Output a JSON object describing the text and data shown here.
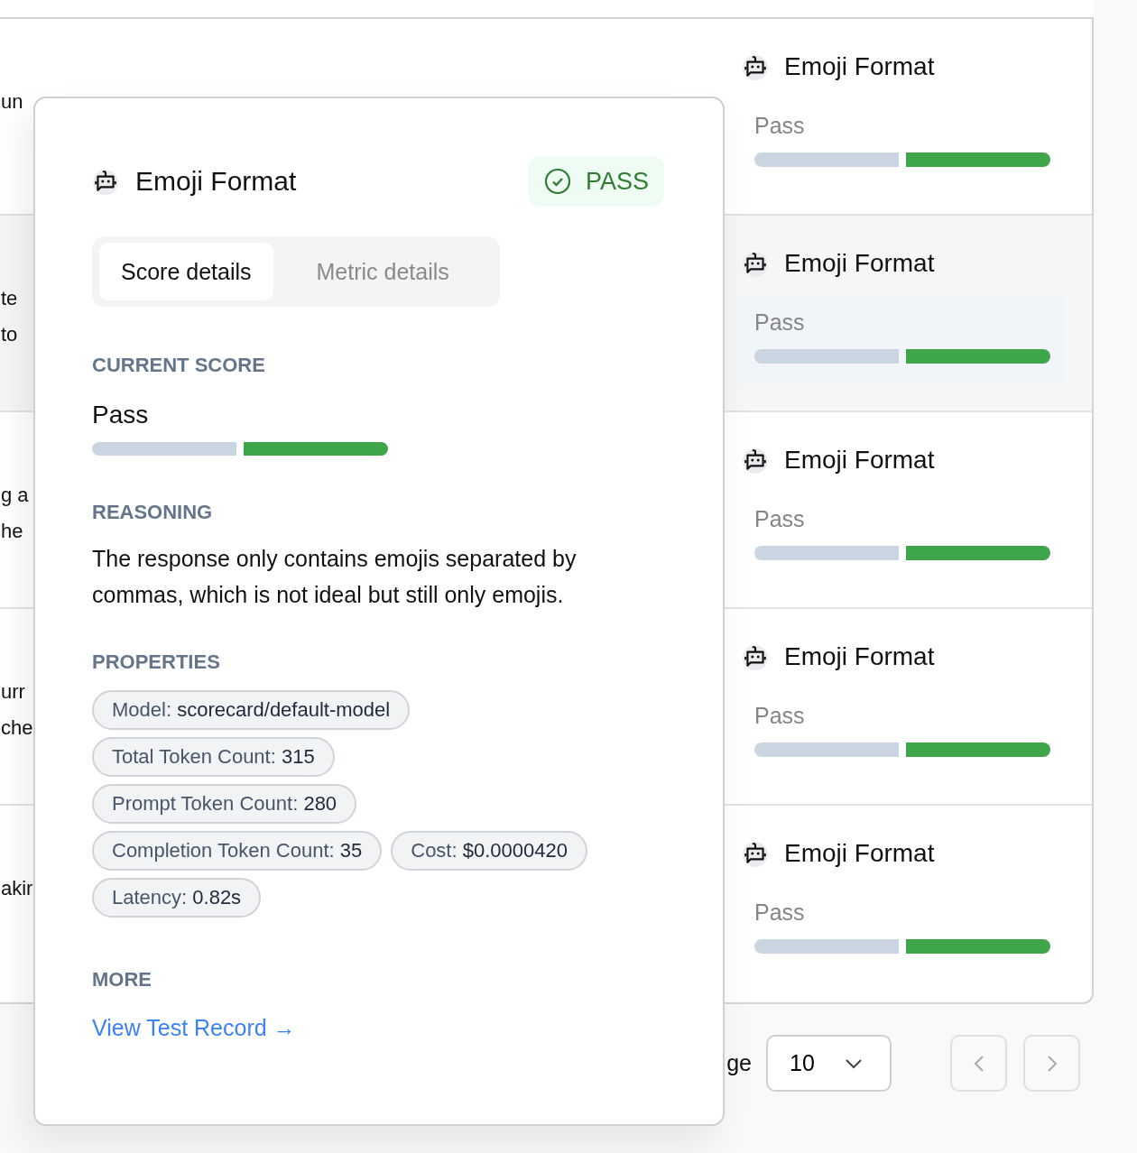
{
  "table": {
    "rows": [
      {
        "snippet": [
          "un"
        ],
        "metric": "Emoji Format",
        "score": "Pass",
        "segments": [
          {
            "on": false
          },
          {
            "on": true
          }
        ],
        "highlighted": false
      },
      {
        "snippet": [
          "te",
          "to"
        ],
        "metric": "Emoji Format",
        "score": "Pass",
        "segments": [
          {
            "on": false
          },
          {
            "on": true
          }
        ],
        "highlighted": true
      },
      {
        "snippet": [
          "g a",
          "he"
        ],
        "metric": "Emoji Format",
        "score": "Pass",
        "segments": [
          {
            "on": false
          },
          {
            "on": true
          }
        ],
        "highlighted": false
      },
      {
        "snippet": [
          "urr",
          "che"
        ],
        "metric": "Emoji Format",
        "score": "Pass",
        "segments": [
          {
            "on": false
          },
          {
            "on": true
          }
        ],
        "highlighted": false
      },
      {
        "snippet": [
          "akir"
        ],
        "metric": "Emoji Format",
        "score": "Pass",
        "segments": [
          {
            "on": false
          },
          {
            "on": true
          }
        ],
        "highlighted": false
      }
    ]
  },
  "pagination": {
    "rows_label": "ge",
    "page_size": "10",
    "prev_disabled": true,
    "next_disabled": true
  },
  "popover": {
    "title": "Emoji Format",
    "status": "PASS",
    "tabs": [
      {
        "label": "Score details",
        "selected": true
      },
      {
        "label": "Metric details",
        "selected": false
      }
    ],
    "current_score": {
      "heading": "CURRENT SCORE",
      "value": "Pass",
      "segments": [
        {
          "on": false
        },
        {
          "on": true
        }
      ]
    },
    "reasoning": {
      "heading": "REASONING",
      "text": "The response only contains emojis separated by commas, which is not ideal but still only emojis."
    },
    "properties": {
      "heading": "PROPERTIES",
      "items": [
        {
          "label": "Model:",
          "value": "scorecard/default-model"
        },
        {
          "label": "Total Token Count:",
          "value": "315"
        },
        {
          "label": "Prompt Token Count:",
          "value": "280"
        },
        {
          "label": "Completion Token Count:",
          "value": "35"
        },
        {
          "label": "Cost:",
          "value": "$0.0000420"
        },
        {
          "label": "Latency:",
          "value": "0.82s"
        }
      ]
    },
    "more": {
      "heading": "MORE",
      "link": "View Test Record →"
    }
  }
}
